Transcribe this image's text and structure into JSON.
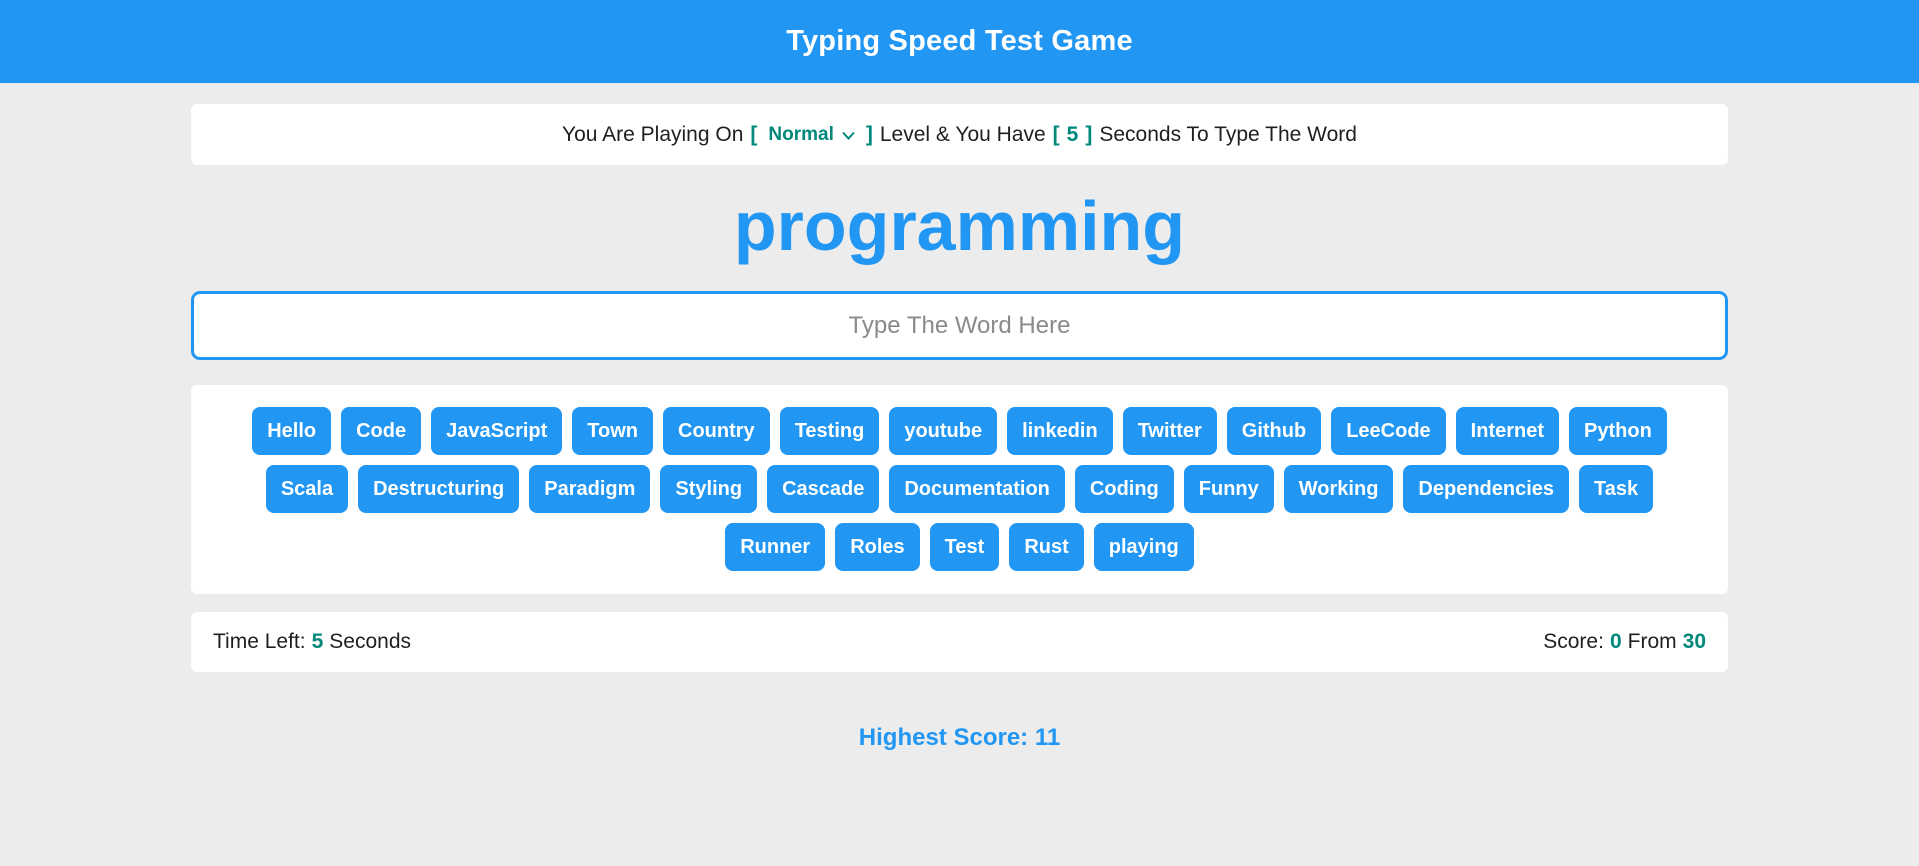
{
  "header": {
    "title": "Typing Speed Test Game"
  },
  "level_bar": {
    "text_before": "You Are Playing On",
    "bracket_open": "[",
    "level": "Normal",
    "bracket_close": "]",
    "text_middle": "Level & You Have",
    "seconds": "5",
    "text_after": "Seconds To Type The Word"
  },
  "current_word": "programming",
  "input": {
    "value": "",
    "placeholder": "Type The Word Here"
  },
  "words": {
    "items": [
      "Hello",
      "Code",
      "JavaScript",
      "Town",
      "Country",
      "Testing",
      "youtube",
      "linkedin",
      "Twitter",
      "Github",
      "LeeCode",
      "Internet",
      "Python",
      "Scala",
      "Destructuring",
      "Paradigm",
      "Styling",
      "Cascade",
      "Documentation",
      "Coding",
      "Funny",
      "Working",
      "Dependencies",
      "Task",
      "Runner",
      "Roles",
      "Test",
      "Rust",
      "playing"
    ]
  },
  "status_bar": {
    "time_label": "Time Left:",
    "time_value": "5",
    "time_unit": "Seconds",
    "score_label": "Score:",
    "score_value": "0",
    "score_from": "From",
    "score_total": "30"
  },
  "footer": {
    "highest_score_label": "Highest Score:",
    "highest_score_value": "11"
  },
  "colors": {
    "accent_blue": "#2196f3",
    "accent_teal": "#00897b",
    "background": "#ececec"
  }
}
